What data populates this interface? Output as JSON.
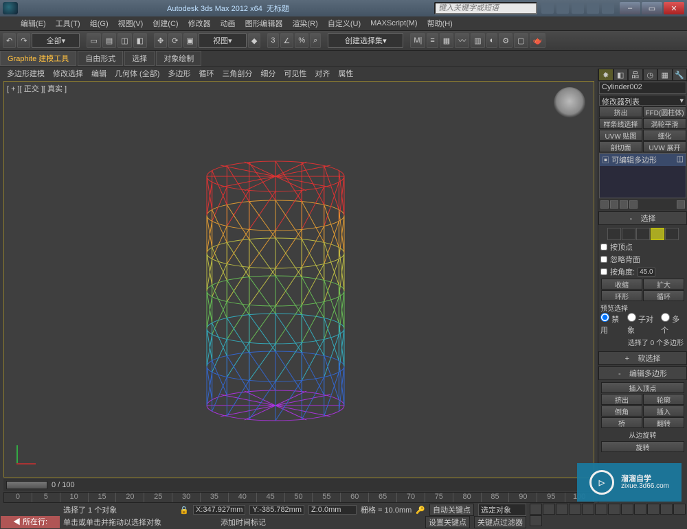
{
  "title": {
    "app": "Autodesk 3ds Max  2012  x64",
    "doc": "无标题"
  },
  "search": {
    "placeholder": "键入关键字或短语"
  },
  "menu": [
    "编辑(E)",
    "工具(T)",
    "组(G)",
    "视图(V)",
    "创建(C)",
    "修改器",
    "动画",
    "图形编辑器",
    "渲染(R)",
    "自定义(U)",
    "MAXScript(M)",
    "帮助(H)"
  ],
  "toolbar": {
    "scope": "全部",
    "view": "视图",
    "set": "创建选择集"
  },
  "ribbon": {
    "tabs": [
      "Graphite 建模工具",
      "自由形式",
      "选择",
      "对象绘制"
    ],
    "sub": [
      "多边形建模",
      "修改选择",
      "编辑",
      "几何体 (全部)",
      "多边形",
      "循环",
      "三角剖分",
      "细分",
      "可见性",
      "对齐",
      "属性"
    ]
  },
  "viewport": {
    "label": "[ + ][ 正交 ][ 真实 ]"
  },
  "panel": {
    "objname": "Cylinder002",
    "modlist": "修改器列表",
    "btns1": [
      "挤出",
      "FFD(圆柱体)"
    ],
    "btns2": [
      "样条线选择",
      "涡轮平滑"
    ],
    "btns3": [
      "UVW 贴图",
      "细化"
    ],
    "btns4": [
      "剖切面",
      "UVW 展开"
    ],
    "stackitem": "可编辑多边形",
    "roll_sel": "选择",
    "byvertex": "按顶点",
    "ignoreback": "忽略背面",
    "byangle": "按角度:",
    "anglev": "45.0",
    "shrink": "收缩",
    "grow": "扩大",
    "ring": "环形",
    "loop": "循环",
    "preview": "预览选择",
    "radios": [
      "禁用",
      "子对象",
      "多个"
    ],
    "selcount": "选择了 0 个多边形",
    "roll_soft": "软选择",
    "roll_edit": "编辑多边形",
    "insvtx": "插入顶点",
    "e_extrude": "挤出",
    "e_outline": "轮廓",
    "e_bevel": "倒角",
    "e_inset": "插入",
    "e_bridge": "桥",
    "e_flip": "翻转",
    "edgerot": "从边旋转",
    "rotate": "旋转"
  },
  "trackbar": {
    "pos": "0 / 100"
  },
  "timeline": [
    0,
    5,
    10,
    15,
    20,
    25,
    30,
    35,
    40,
    45,
    50,
    55,
    60,
    65,
    70,
    75,
    80,
    85,
    90,
    95,
    100
  ],
  "status": {
    "tag": "所在行:",
    "line1": "选择了 1 个对象",
    "line2": "单击或单击并拖动以选择对象",
    "addmarker": "添加时间标记",
    "x": "347.927mm",
    "y": "-385.782mm",
    "z": "0.0mm",
    "grid": "栅格 = 10.0mm",
    "autokey": "自动关键点",
    "selset": "选定对象",
    "setkey": "设置关键点",
    "keyfilter": "关键点过滤器"
  },
  "wm": {
    "text": "溜溜自学",
    "url": "zixue.3d66.com"
  }
}
